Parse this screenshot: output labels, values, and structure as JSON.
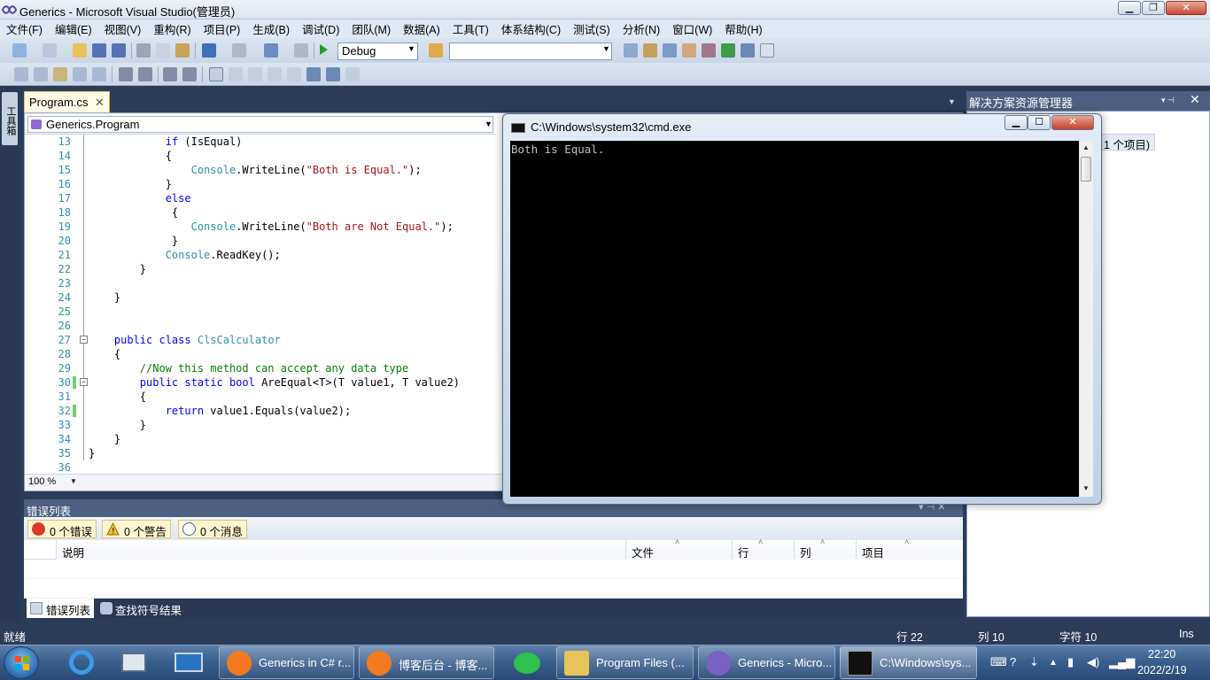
{
  "window": {
    "title": "Generics - Microsoft Visual Studio(管理员)",
    "min_label": "▁",
    "max_label": "❐",
    "close_label": "✕"
  },
  "menu": [
    "文件(F)",
    "编辑(E)",
    "视图(V)",
    "重构(R)",
    "项目(P)",
    "生成(B)",
    "调试(D)",
    "团队(M)",
    "数据(A)",
    "工具(T)",
    "体系结构(C)",
    "测试(S)",
    "分析(N)",
    "窗口(W)",
    "帮助(H)"
  ],
  "toolbar": {
    "configuration": "Debug",
    "find_value": ""
  },
  "toolbox": {
    "label": "工具箱"
  },
  "editor": {
    "tab_label": "Program.cs",
    "tab_close": "✕",
    "nav_value": "Generics.Program",
    "zoom": "100 %",
    "lines": [
      {
        "n": "13",
        "parts": [
          {
            "t": "            "
          },
          {
            "t": "if",
            "c": "kw"
          },
          {
            "t": " (IsEqual)"
          }
        ]
      },
      {
        "n": "14",
        "parts": [
          {
            "t": "            {"
          }
        ]
      },
      {
        "n": "15",
        "parts": [
          {
            "t": "                "
          },
          {
            "t": "Console",
            "c": "ty"
          },
          {
            "t": ".WriteLine("
          },
          {
            "t": "\"Both is Equal.\"",
            "c": "str"
          },
          {
            "t": ");"
          }
        ]
      },
      {
        "n": "16",
        "parts": [
          {
            "t": "            }"
          }
        ]
      },
      {
        "n": "17",
        "parts": [
          {
            "t": "            "
          },
          {
            "t": "else",
            "c": "kw"
          }
        ]
      },
      {
        "n": "18",
        "parts": [
          {
            "t": "             {"
          }
        ]
      },
      {
        "n": "19",
        "parts": [
          {
            "t": "                "
          },
          {
            "t": "Console",
            "c": "ty"
          },
          {
            "t": ".WriteLine("
          },
          {
            "t": "\"Both are Not Equal.\"",
            "c": "str"
          },
          {
            "t": ");"
          }
        ]
      },
      {
        "n": "20",
        "parts": [
          {
            "t": "             }"
          }
        ]
      },
      {
        "n": "21",
        "parts": [
          {
            "t": "            "
          },
          {
            "t": "Console",
            "c": "ty"
          },
          {
            "t": ".ReadKey();"
          }
        ]
      },
      {
        "n": "22",
        "parts": [
          {
            "t": "        }"
          }
        ]
      },
      {
        "n": "23",
        "parts": [
          {
            "t": ""
          }
        ]
      },
      {
        "n": "24",
        "parts": [
          {
            "t": "    }"
          }
        ]
      },
      {
        "n": "25",
        "parts": [
          {
            "t": ""
          }
        ]
      },
      {
        "n": "26",
        "parts": [
          {
            "t": ""
          }
        ]
      },
      {
        "n": "27",
        "parts": [
          {
            "t": "    "
          },
          {
            "t": "public class",
            "c": "kw"
          },
          {
            "t": " "
          },
          {
            "t": "ClsCalculator",
            "c": "ty"
          }
        ]
      },
      {
        "n": "28",
        "parts": [
          {
            "t": "    {"
          }
        ]
      },
      {
        "n": "29",
        "parts": [
          {
            "t": "        "
          },
          {
            "t": "//Now this method can accept any data type",
            "c": "cm"
          }
        ]
      },
      {
        "n": "30",
        "parts": [
          {
            "t": "        "
          },
          {
            "t": "public static bool",
            "c": "kw"
          },
          {
            "t": " AreEqual<T>(T value1, T value2)"
          }
        ]
      },
      {
        "n": "31",
        "parts": [
          {
            "t": "        {"
          }
        ]
      },
      {
        "n": "32",
        "parts": [
          {
            "t": "            "
          },
          {
            "t": "return",
            "c": "kw"
          },
          {
            "t": " value1.Equals(value2);"
          }
        ]
      },
      {
        "n": "33",
        "parts": [
          {
            "t": "        }"
          }
        ]
      },
      {
        "n": "34",
        "parts": [
          {
            "t": "    }"
          }
        ]
      },
      {
        "n": "35",
        "parts": [
          {
            "t": "}"
          }
        ]
      },
      {
        "n": "36",
        "parts": [
          {
            "t": ""
          }
        ]
      }
    ]
  },
  "solution_explorer": {
    "title": "解决方案资源管理器",
    "item": "1 个项目)",
    "pin": "▾ ⊣",
    "close": "✕"
  },
  "cmd": {
    "title": "C:\\Windows\\system32\\cmd.exe",
    "output": "Both is Equal.",
    "min": "▁",
    "max": "☐",
    "close": "✕"
  },
  "error_list": {
    "title": "错误列表",
    "controls": "▾ ⊣ ✕",
    "errors": "0 个错误",
    "warnings": "0 个警告",
    "messages": "0 个消息",
    "columns": [
      "说明",
      "文件",
      "行",
      "列",
      "项目"
    ],
    "tab_active": "错误列表",
    "tab_find": "查找符号结果"
  },
  "status": {
    "ready": "就绪",
    "line": "行 22",
    "col": "列 10",
    "char": "字符 10",
    "mode": "Ins"
  },
  "taskbar": {
    "buttons": [
      {
        "label": "Generics in C# r...",
        "color": "#f37a20"
      },
      {
        "label": "博客后台 - 博客...",
        "color": "#f37a20"
      },
      {
        "label": "Program Files (...",
        "color": "#e8c35a"
      },
      {
        "label": "Generics - Micro...",
        "color": "#7a5fc4"
      },
      {
        "label": "C:\\Windows\\sys...",
        "color": "#111111"
      }
    ],
    "time": "22:20",
    "date": "2022/2/19"
  }
}
